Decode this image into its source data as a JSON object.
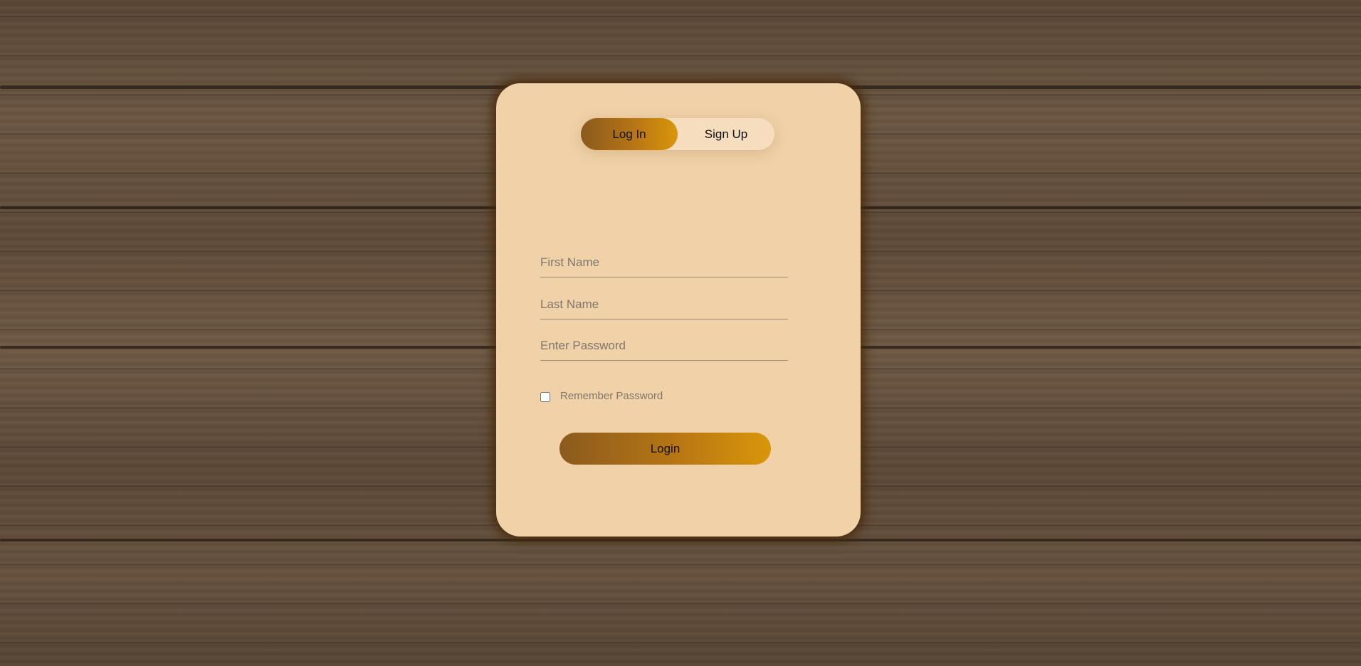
{
  "colors": {
    "card_background": "#f0d1a8",
    "accent_gradient_start": "#8b5a1e",
    "accent_gradient_end": "#d9960a"
  },
  "tabs": [
    {
      "label": "Log In",
      "active": true
    },
    {
      "label": "Sign Up",
      "active": false
    }
  ],
  "form": {
    "first_name_placeholder": "First Name",
    "last_name_placeholder": "Last Name",
    "password_placeholder": "Enter Password",
    "remember_label": "Remember Password",
    "remember_checked": false,
    "submit_label": "Login"
  }
}
